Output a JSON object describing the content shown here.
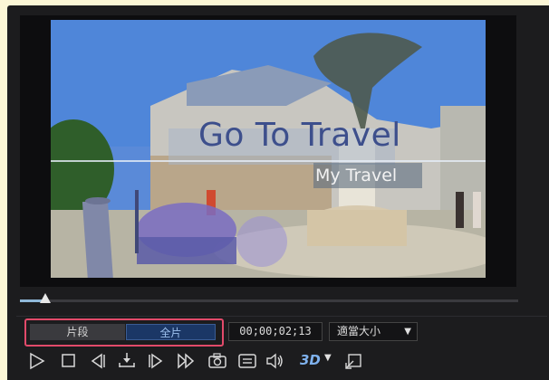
{
  "preview": {
    "title_text": "Go To Travel",
    "subtitle_text": "My Travel"
  },
  "playback": {
    "progress": 0.05
  },
  "mode": {
    "clip_label": "片段",
    "full_label": "全片",
    "selected": "full"
  },
  "timecode": "00;00;02;13",
  "zoom": {
    "selected": "適當大小"
  },
  "controls": {
    "buttons": [
      "play-icon",
      "stop-icon",
      "previous-frame-icon",
      "split-icon",
      "next-frame-icon",
      "fast-forward-icon",
      "snapshot-icon",
      "subtitle-icon",
      "volume-icon",
      "3d-toggle",
      "undock-icon"
    ],
    "badge_3d": "3D"
  },
  "colors": {
    "background": "#fbf6d6",
    "panel": "#1c1c1e",
    "highlight": "#e24a6a",
    "accent": "#1b3766"
  }
}
